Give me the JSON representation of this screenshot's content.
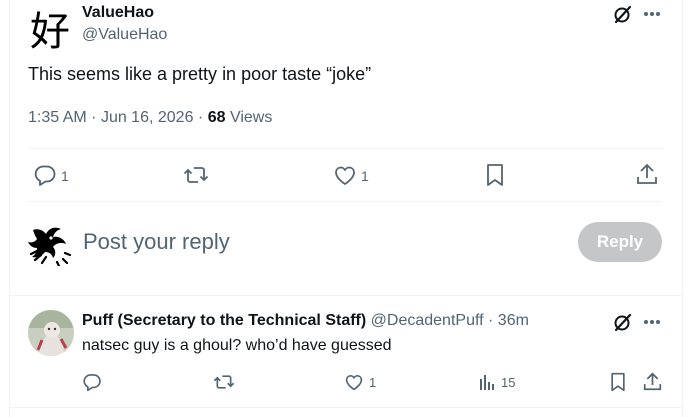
{
  "main_post": {
    "avatar_glyph": "好",
    "display_name": "ValueHao",
    "handle": "@ValueHao",
    "text": "This seems like a pretty in poor taste “joke”",
    "time": "1:35 AM",
    "dot1": "·",
    "date": "Jun 16, 2026",
    "dot2": "·",
    "views_count": "68",
    "views_label": "Views",
    "actions": {
      "reply_count": "1",
      "repost_count": "",
      "like_count": "1"
    }
  },
  "composer": {
    "placeholder": "Post your reply",
    "button_label": "Reply"
  },
  "reply_post": {
    "display_name": "Puff (Secretary to the Technical Staff)",
    "handle": "@DecadentPuff",
    "dot": "·",
    "time_ago": "36m",
    "text": "natsec guy is a ghoul? who’d have guessed",
    "actions": {
      "reply_count": "",
      "repost_count": "",
      "like_count": "1",
      "views_count": "15"
    }
  },
  "colors": {
    "text": "#0f1419",
    "muted": "#536471",
    "divider": "#eff3f4",
    "disabled_button": "#c4c6c8"
  },
  "icons": [
    "grok-icon",
    "more-icon",
    "reply-icon",
    "repost-icon",
    "like-icon",
    "bookmark-icon",
    "share-icon",
    "analytics-icon"
  ]
}
